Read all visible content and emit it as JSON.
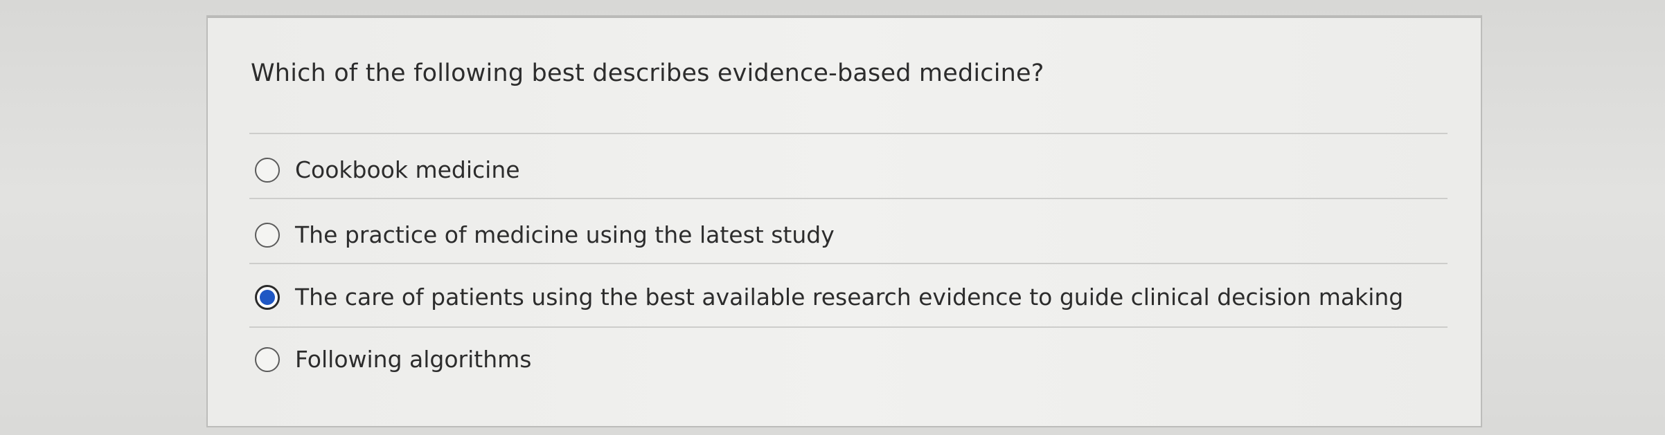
{
  "question": {
    "text": "Which of the following best describes evidence-based medicine?"
  },
  "options": [
    {
      "label": "Cookbook medicine",
      "selected": false
    },
    {
      "label": "The practice of medicine using the latest study",
      "selected": false
    },
    {
      "label": "The care of patients using the best available research evidence to guide clinical decision making",
      "selected": true
    },
    {
      "label": "Following algorithms",
      "selected": false
    }
  ],
  "colors": {
    "selected_radio": "#1f57c4",
    "text": "#2c2c2c",
    "card_background": "#f0f0ee"
  }
}
